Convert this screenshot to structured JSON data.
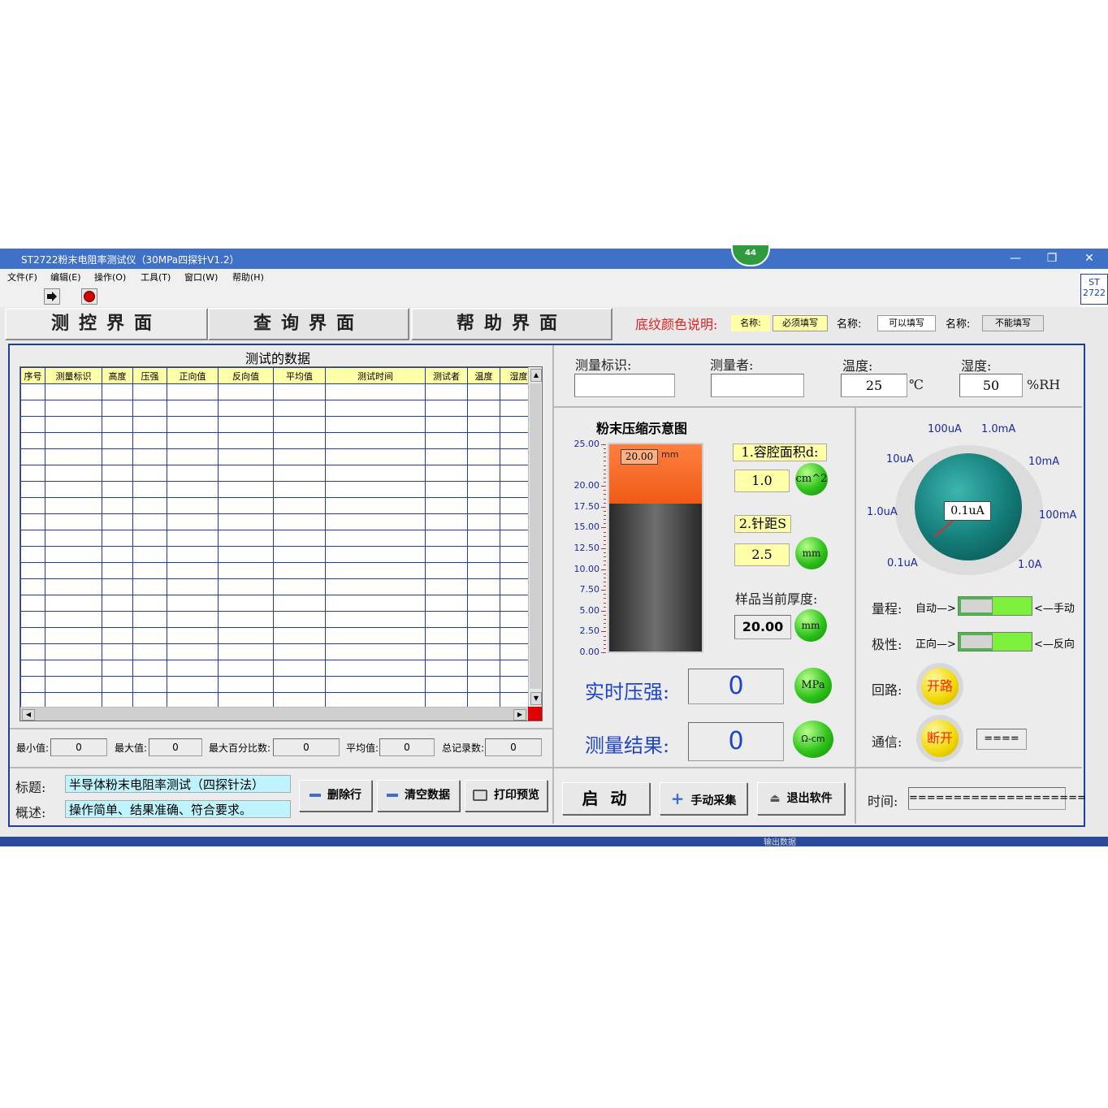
{
  "window": {
    "title": "ST2722粉末电阻率测试仪（30MPa四探针V1.2）",
    "badge_number": "44",
    "minimize": "—",
    "restore": "❐",
    "close": "✕"
  },
  "menu": [
    "文件(F)",
    "编辑(E)",
    "操作(O)",
    "工具(T)",
    "窗口(W)",
    "帮助(H)"
  ],
  "side_badge": {
    "line1": "ST",
    "line2": "2722"
  },
  "tabs": [
    "测控界面",
    "查询界面",
    "帮助界面"
  ],
  "legend": {
    "title": "底纹颜色说明:",
    "name_label": "名称:",
    "items": [
      "必须填写",
      "可以填写",
      "不能填写"
    ]
  },
  "table": {
    "title": "测试的数据",
    "columns": [
      "序号",
      "测量标识",
      "高度",
      "压强",
      "正向值",
      "反向值",
      "平均值",
      "测试时间",
      "测试者",
      "温度",
      "湿度"
    ],
    "row_count": 20
  },
  "stats": {
    "min_label": "最小值:",
    "min_value": "0",
    "max_label": "最大值:",
    "max_value": "0",
    "pct_label": "最大百分比数:",
    "pct_value": "0",
    "avg_label": "平均值:",
    "avg_value": "0",
    "count_label": "总记录数:",
    "count_value": "0"
  },
  "bottom_left": {
    "title_label": "标题:",
    "title_value": "半导体粉末电阻率测试（四探针法）",
    "desc_label": "概述:",
    "desc_value": "操作简单、结果准确、符合要求。",
    "delete_row": "删除行",
    "clear_data": "清空数据",
    "print_preview": "打印预览"
  },
  "info": {
    "id_label": "测量标识:",
    "id_value": "",
    "operator_label": "测量者:",
    "operator_value": "",
    "temp_label": "温度:",
    "temp_value": "25",
    "temp_unit": "℃",
    "humid_label": "湿度:",
    "humid_value": "50",
    "humid_unit": "%RH"
  },
  "compression": {
    "title": "粉末压缩示意图",
    "level": 20.0,
    "level_display": "20.00",
    "level_unit": "mm",
    "ticks": [
      "25.00",
      "20.00",
      "17.50",
      "15.00",
      "12.50",
      "10.00",
      "7.50",
      "5.00",
      "2.50",
      "0.00"
    ],
    "area_label": "1.容腔面积d:",
    "area_value": "1.0",
    "area_unit": "cm^2",
    "spacing_label": "2.针距S",
    "spacing_value": "2.5",
    "spacing_unit": "mm",
    "thickness_label": "样品当前厚度:",
    "thickness_value": "20.00",
    "thickness_unit": "mm",
    "pressure_label": "实时压强:",
    "pressure_value": "0",
    "pressure_unit": "MPa",
    "result_label": "测量结果:",
    "result_value": "0",
    "result_unit": "Ω-cm"
  },
  "range_knob": {
    "labels": [
      "0.1uA",
      "1.0uA",
      "10uA",
      "100uA",
      "1.0mA",
      "10mA",
      "100mA",
      "1.0A"
    ],
    "value": "0.1uA"
  },
  "switches": {
    "range_label": "量程:",
    "range_left": "自动—>",
    "range_right": "<—手动",
    "polarity_label": "极性:",
    "polarity_left": "正向—>",
    "polarity_right": "<—反向"
  },
  "circuit": {
    "label": "回路:",
    "state": "开路"
  },
  "comm": {
    "label": "通信:",
    "state": "断开",
    "display": "===="
  },
  "actions": {
    "start": "启 动",
    "manual": "手动采集",
    "exit": "退出软件"
  },
  "time": {
    "label": "时间:",
    "value": "===================="
  },
  "taskbar_fragment": "输出数据"
}
